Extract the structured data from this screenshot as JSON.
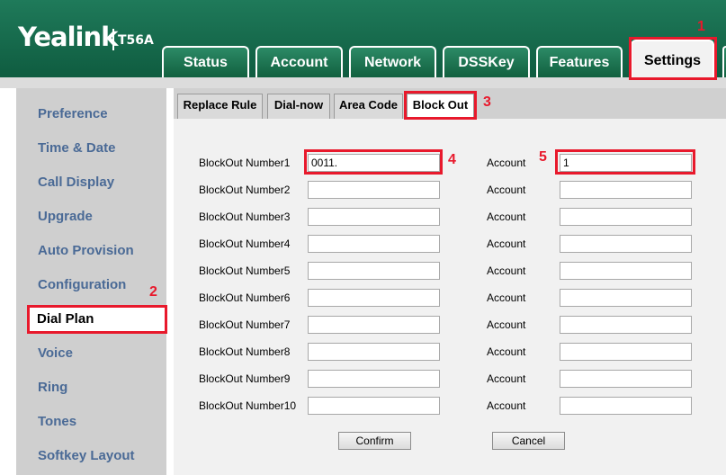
{
  "header": {
    "brand": "Yealink",
    "model": "T56A",
    "tabs": [
      {
        "label": "Status"
      },
      {
        "label": "Account"
      },
      {
        "label": "Network"
      },
      {
        "label": "DSSKey"
      },
      {
        "label": "Features"
      },
      {
        "label": "Settings",
        "active": true
      }
    ]
  },
  "sidebar": {
    "items": [
      {
        "label": "Preference"
      },
      {
        "label": "Time & Date"
      },
      {
        "label": "Call Display"
      },
      {
        "label": "Upgrade"
      },
      {
        "label": "Auto Provision"
      },
      {
        "label": "Configuration"
      },
      {
        "label": "Dial Plan",
        "active": true
      },
      {
        "label": "Voice"
      },
      {
        "label": "Ring"
      },
      {
        "label": "Tones"
      },
      {
        "label": "Softkey Layout"
      }
    ]
  },
  "subtabs": [
    {
      "label": "Replace Rule"
    },
    {
      "label": "Dial-now"
    },
    {
      "label": "Area Code"
    },
    {
      "label": "Block Out",
      "active": true
    }
  ],
  "blockout": {
    "account_label": "Account",
    "rows": [
      {
        "label": "BlockOut Number1",
        "number": "0011.",
        "account": "1"
      },
      {
        "label": "BlockOut Number2",
        "number": "",
        "account": ""
      },
      {
        "label": "BlockOut Number3",
        "number": "",
        "account": ""
      },
      {
        "label": "BlockOut Number4",
        "number": "",
        "account": ""
      },
      {
        "label": "BlockOut Number5",
        "number": "",
        "account": ""
      },
      {
        "label": "BlockOut Number6",
        "number": "",
        "account": ""
      },
      {
        "label": "BlockOut Number7",
        "number": "",
        "account": ""
      },
      {
        "label": "BlockOut Number8",
        "number": "",
        "account": ""
      },
      {
        "label": "BlockOut Number9",
        "number": "",
        "account": ""
      },
      {
        "label": "BlockOut Number10",
        "number": "",
        "account": ""
      }
    ]
  },
  "buttons": {
    "confirm": "Confirm",
    "cancel": "Cancel"
  },
  "annotations": {
    "m1": "1",
    "m2": "2",
    "m3": "3",
    "m4": "4",
    "m5": "5"
  },
  "colors": {
    "header_green": "#1f7a5a",
    "sidebar_text": "#4a6a96",
    "highlight_red": "#e8192c"
  }
}
